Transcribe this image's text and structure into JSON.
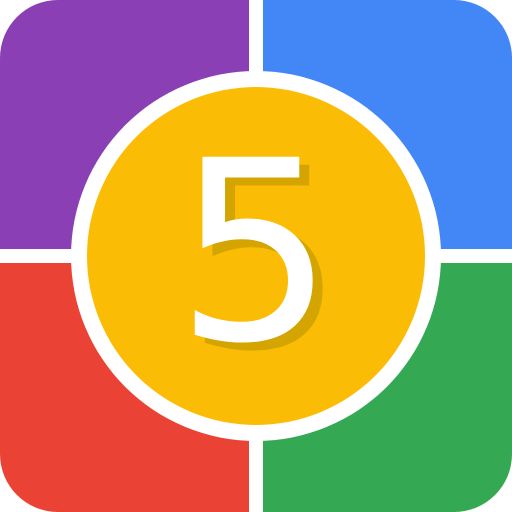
{
  "icon": {
    "digit": "5",
    "colors": {
      "top_left": "#8B3FB5",
      "top_right": "#4287F5",
      "bottom_left": "#EA4335",
      "bottom_right": "#34A853",
      "center_disc": "#FBBC05",
      "ring": "#FFFFFF",
      "digit": "#FFFFFF",
      "digit_shadow": "#D4A500"
    }
  }
}
